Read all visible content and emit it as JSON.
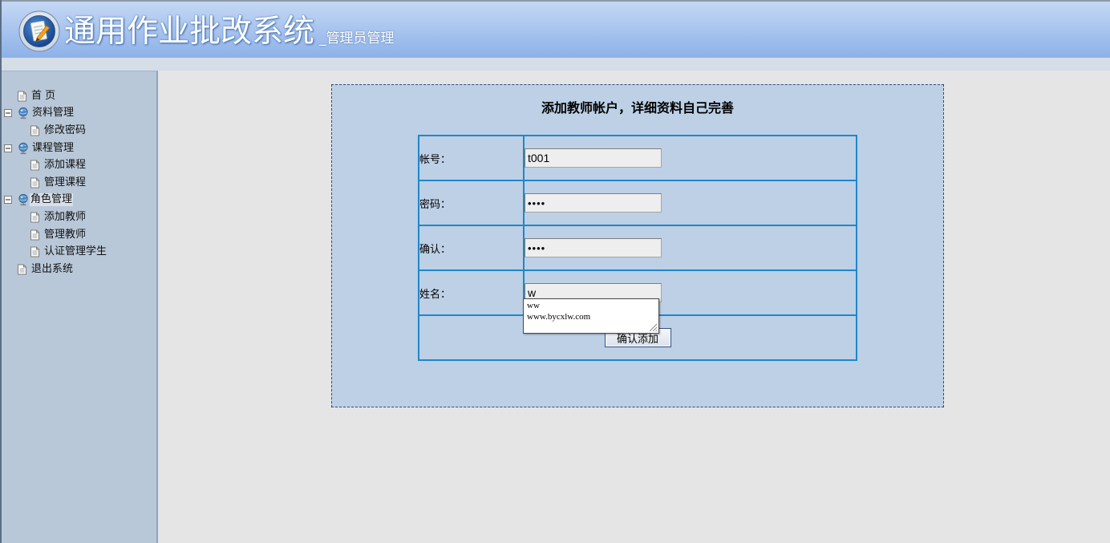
{
  "colors": {
    "header_top": "#c4d8f4",
    "header_bottom": "#8db1e8",
    "sidebar_bg": "#b9c8d8",
    "panel_bg": "#bdd0e6",
    "table_border": "#1f87c8",
    "page_bg": "#e5e5e5"
  },
  "header": {
    "logo_icon": "notepad-pencil-logo-icon",
    "title": "通用作业批改系统",
    "subtitle": "_管理员管理"
  },
  "sidebar": {
    "home": {
      "label": "首 页",
      "icon": "page-icon"
    },
    "groups": [
      {
        "label": "资料管理",
        "icon": "globe-icon",
        "expanded": true,
        "selected": false,
        "children": [
          {
            "label": "修改密码",
            "icon": "page-icon"
          }
        ]
      },
      {
        "label": "课程管理",
        "icon": "globe-icon",
        "expanded": true,
        "selected": false,
        "children": [
          {
            "label": "添加课程",
            "icon": "page-icon"
          },
          {
            "label": "管理课程",
            "icon": "page-icon"
          }
        ]
      },
      {
        "label": "角色管理",
        "icon": "globe-icon",
        "expanded": true,
        "selected": true,
        "children": [
          {
            "label": "添加教师",
            "icon": "page-icon"
          },
          {
            "label": "管理教师",
            "icon": "page-icon"
          },
          {
            "label": "认证管理学生",
            "icon": "page-icon"
          }
        ]
      }
    ],
    "logout": {
      "label": "退出系统",
      "icon": "page-icon"
    }
  },
  "form": {
    "title": "添加教师帐户，详细资料自己完善",
    "fields": [
      {
        "label": "帐号：",
        "value": "t001"
      },
      {
        "label": "密码：",
        "value": "••••"
      },
      {
        "label": "确认：",
        "value": "••••"
      },
      {
        "label": "姓名：",
        "value": "w"
      }
    ],
    "submit_label": "确认添加"
  },
  "autocomplete": {
    "suggestions": [
      "ww",
      "www.bycxlw.com"
    ]
  }
}
